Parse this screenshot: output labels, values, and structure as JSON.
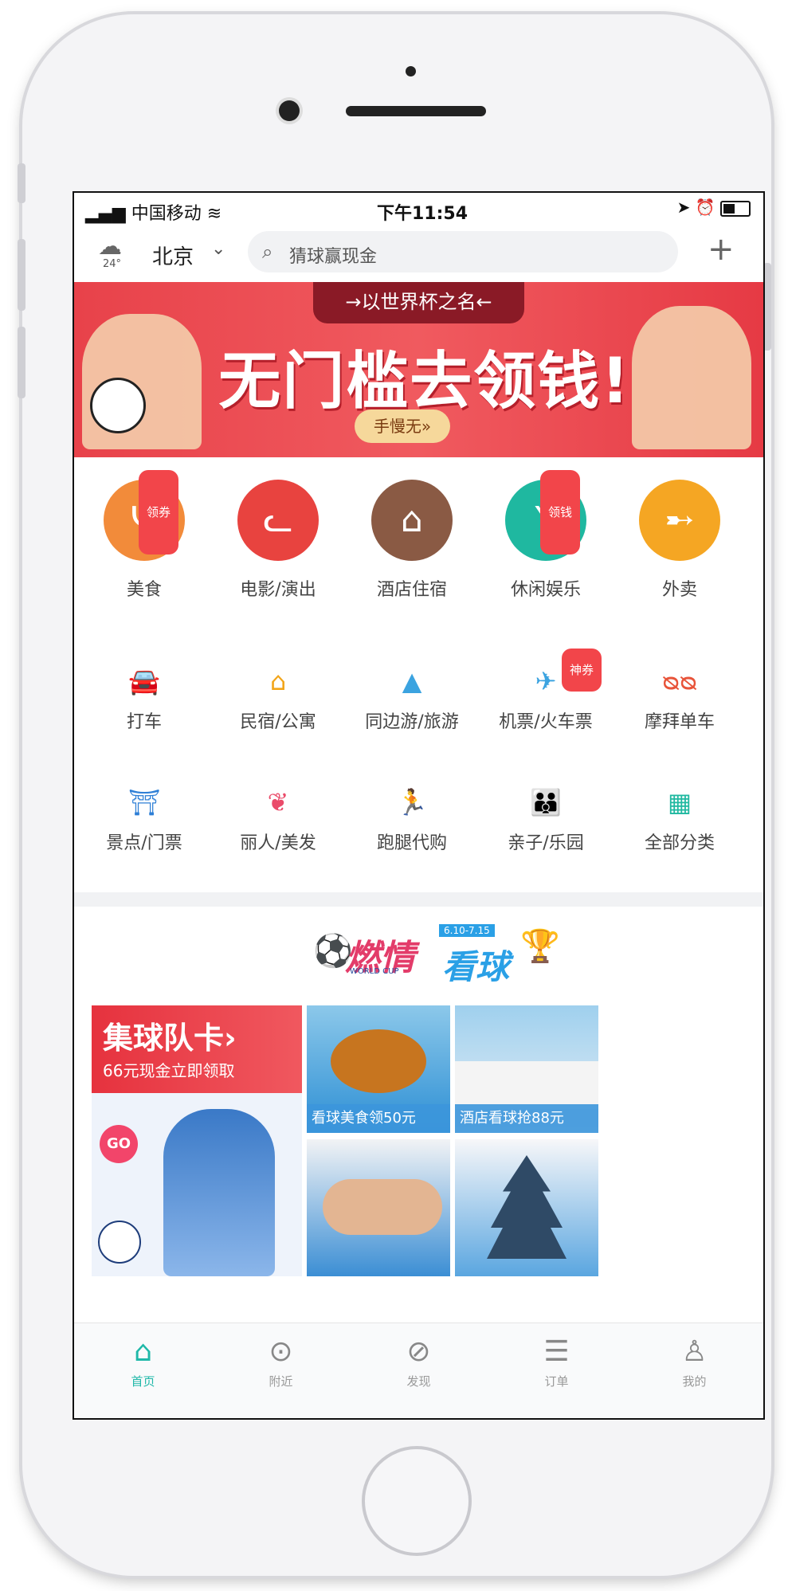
{
  "status_bar": {
    "carrier": "中国移动",
    "time": "下午11:54"
  },
  "header": {
    "weather_temp": "24°",
    "city": "北京",
    "search_placeholder": "猜球赢现金"
  },
  "banner": {
    "top_text": "→以世界杯之名←",
    "main_text": "无门槛去领钱!",
    "button_text": "手慢无»"
  },
  "big_categories": [
    {
      "label": "美食",
      "badge": "领券",
      "icon": "fork-knife-icon",
      "color": "#f28b3a"
    },
    {
      "label": "电影/演出",
      "badge": "",
      "icon": "cat-face-icon",
      "color": "#e8433f"
    },
    {
      "label": "酒店住宿",
      "badge": "",
      "icon": "hotel-icon",
      "color": "#8a5a44"
    },
    {
      "label": "休闲娱乐",
      "badge": "领钱",
      "icon": "cocktail-icon",
      "color": "#1fb8a0"
    },
    {
      "label": "外卖",
      "badge": "",
      "icon": "delivery-icon",
      "color": "#f5a623"
    }
  ],
  "small_categories_row1": [
    {
      "label": "打车",
      "badge": "",
      "icon": "car-icon",
      "color": "#2e7fd6"
    },
    {
      "label": "民宿/公寓",
      "badge": "",
      "icon": "house-icon",
      "color": "#f2a51a"
    },
    {
      "label": "同边游/旅游",
      "badge": "",
      "icon": "mountain-icon",
      "color": "#3ba3e0"
    },
    {
      "label": "机票/火车票",
      "badge": "神券",
      "icon": "plane-icon",
      "color": "#3ba3e0"
    },
    {
      "label": "摩拜单车",
      "badge": "",
      "icon": "bike-icon",
      "color": "#e8543a"
    }
  ],
  "small_categories_row2": [
    {
      "label": "景点/门票",
      "icon": "landmark-icon",
      "color": "#2e7fd6"
    },
    {
      "label": "丽人/美发",
      "icon": "beauty-icon",
      "color": "#ea4b6a"
    },
    {
      "label": "跑腿代购",
      "icon": "runner-icon",
      "color": "#f2a51a"
    },
    {
      "label": "亲子/乐园",
      "icon": "family-icon",
      "color": "#ea4b6a"
    },
    {
      "label": "全部分类",
      "icon": "grid-icon",
      "color": "#1fb8a0"
    }
  ],
  "world_cup": {
    "title_main": "燃情",
    "title_sub": "看球",
    "date_tag": "6.10-7.15",
    "small_text": "WORLD CUP"
  },
  "promo": {
    "title": "集球队卡›",
    "subtitle": "66元现金立即领取",
    "go": "GO",
    "tile1_caption": "看球美食领50元",
    "tile2_caption": "酒店看球抢88元"
  },
  "tabs": [
    {
      "label": "首页",
      "icon": "home-icon",
      "active": true
    },
    {
      "label": "附近",
      "icon": "location-pin-icon",
      "active": false
    },
    {
      "label": "发现",
      "icon": "compass-icon",
      "active": false
    },
    {
      "label": "订单",
      "icon": "order-list-icon",
      "active": false
    },
    {
      "label": "我的",
      "icon": "user-icon",
      "active": false
    }
  ],
  "colors": {
    "accent": "#1fb8a8",
    "banner_red": "#e8424a",
    "badge_red": "#f2454a"
  }
}
